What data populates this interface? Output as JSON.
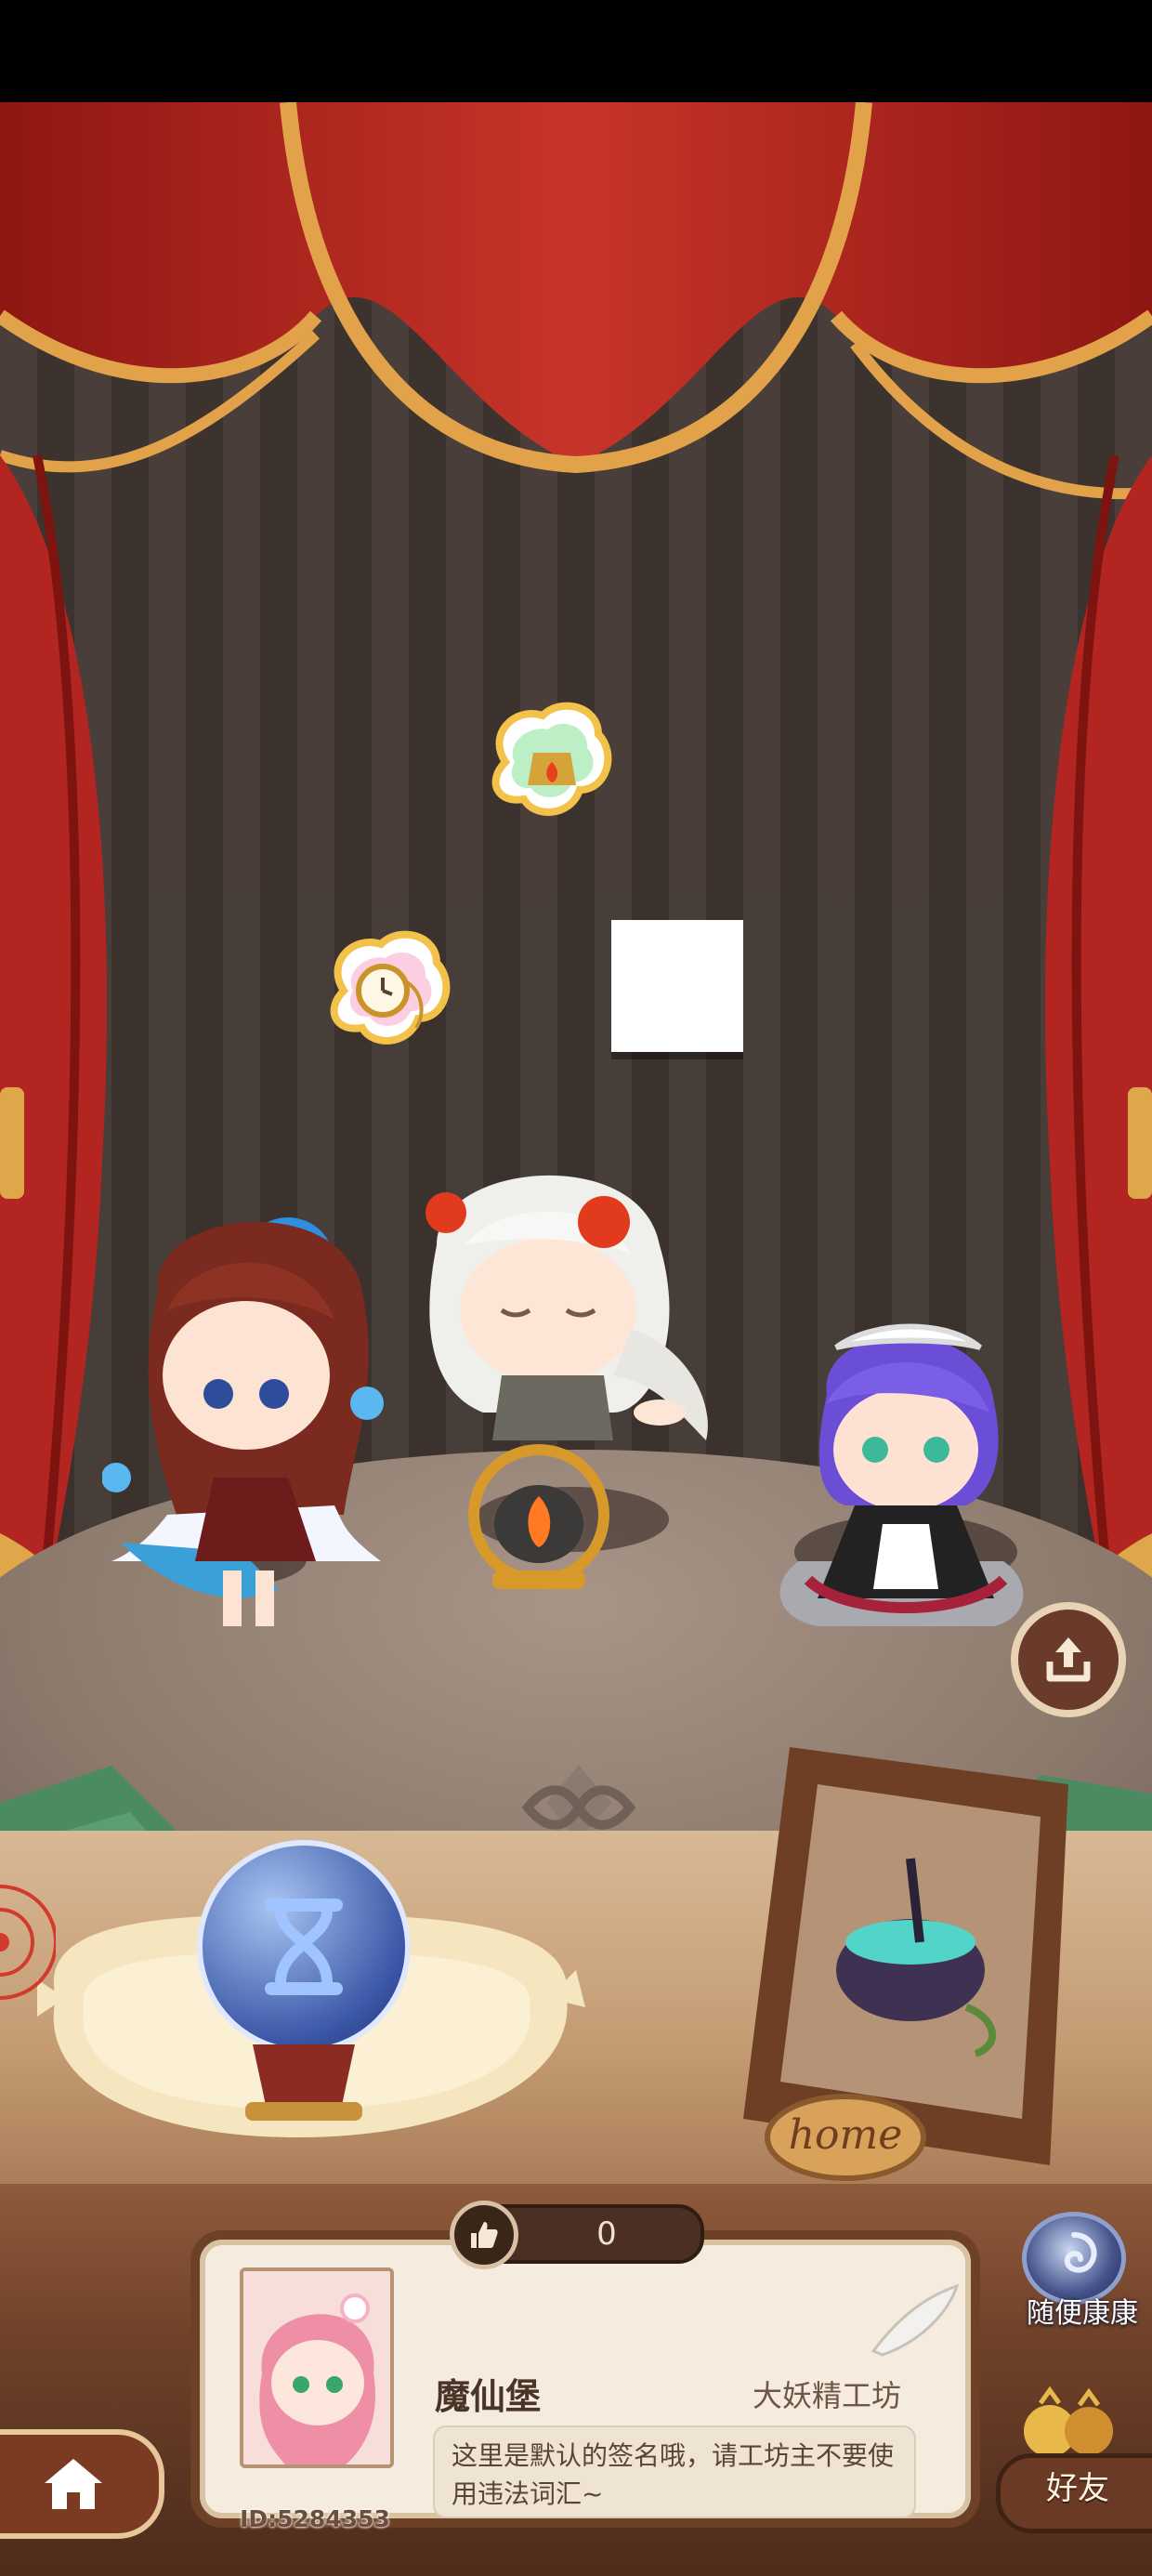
{
  "statusbar": {
    "bg": "#000000"
  },
  "profile": {
    "likes": "0",
    "username": "魔仙堡",
    "workshop": "大妖精工坊",
    "signature": "这里是默认的签名哦，请工坊主不要使用违法词汇~",
    "user_id": "ID:5284353"
  },
  "buttons": {
    "random_visit": "随便康康",
    "friends": "好友",
    "home_frame_text": "home"
  },
  "icons": {
    "share": "share-upload-icon",
    "hourglass": "hourglass-icon",
    "home": "house-icon",
    "likes": "thumbs-up-icon",
    "quill": "quill-icon"
  },
  "colors": {
    "curtain": "#b8261f",
    "curtain_trim": "#e2a24a",
    "card_border": "#6d4126",
    "card_bg": "#f5ecdf"
  }
}
